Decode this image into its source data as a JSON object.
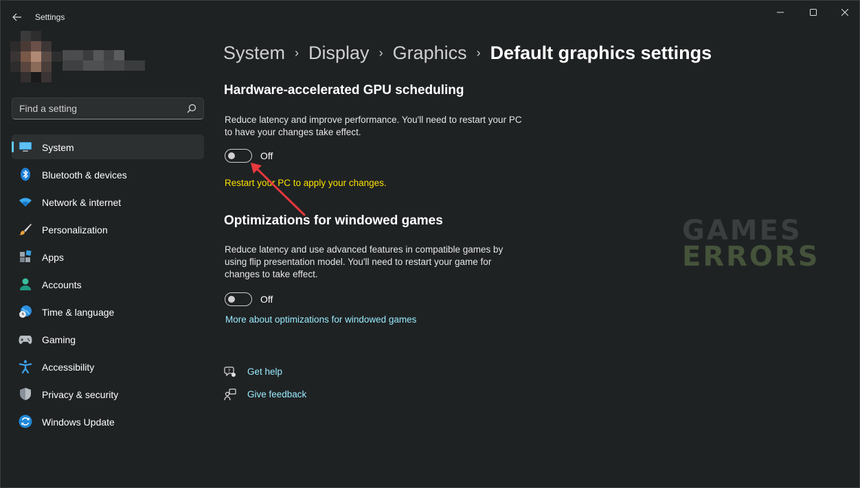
{
  "window": {
    "title": "Settings"
  },
  "search": {
    "placeholder": "Find a setting"
  },
  "sidebar": {
    "items": [
      {
        "label": "System",
        "icon": "monitor-icon",
        "active": true
      },
      {
        "label": "Bluetooth & devices",
        "icon": "bluetooth-icon"
      },
      {
        "label": "Network & internet",
        "icon": "wifi-icon"
      },
      {
        "label": "Personalization",
        "icon": "paintbrush-icon"
      },
      {
        "label": "Apps",
        "icon": "apps-icon"
      },
      {
        "label": "Accounts",
        "icon": "person-icon"
      },
      {
        "label": "Time & language",
        "icon": "clock-globe-icon"
      },
      {
        "label": "Gaming",
        "icon": "gamepad-icon"
      },
      {
        "label": "Accessibility",
        "icon": "accessibility-icon"
      },
      {
        "label": "Privacy & security",
        "icon": "shield-icon"
      },
      {
        "label": "Windows Update",
        "icon": "update-icon"
      }
    ]
  },
  "breadcrumb": {
    "items": [
      "System",
      "Display",
      "Graphics",
      "Default graphics settings"
    ],
    "separator": "›"
  },
  "gpu_scheduling": {
    "title": "Hardware-accelerated GPU scheduling",
    "description_line1": "Reduce latency and improve performance. You'll need to restart your PC",
    "description_line2": "to have your changes take effect.",
    "toggle_state": "Off",
    "warning": "Restart your PC to apply your changes."
  },
  "windowed_games": {
    "title": "Optimizations for windowed games",
    "description_line1": "Reduce latency and use advanced features in compatible games by",
    "description_line2": "using flip presentation model. You'll need to restart your game for",
    "description_line3": "changes to take effect.",
    "toggle_state": "Off",
    "more_link": "More about optimizations for windowed games"
  },
  "help": {
    "get_help": "Get help",
    "give_feedback": "Give feedback"
  },
  "watermark": {
    "line1": "GAMES",
    "line2": "ERRORS"
  },
  "colors": {
    "accent": "#60cdff",
    "link": "#99ebff",
    "warning": "#fce100",
    "background": "#1f2223",
    "annotation_arrow": "#e8383d"
  }
}
